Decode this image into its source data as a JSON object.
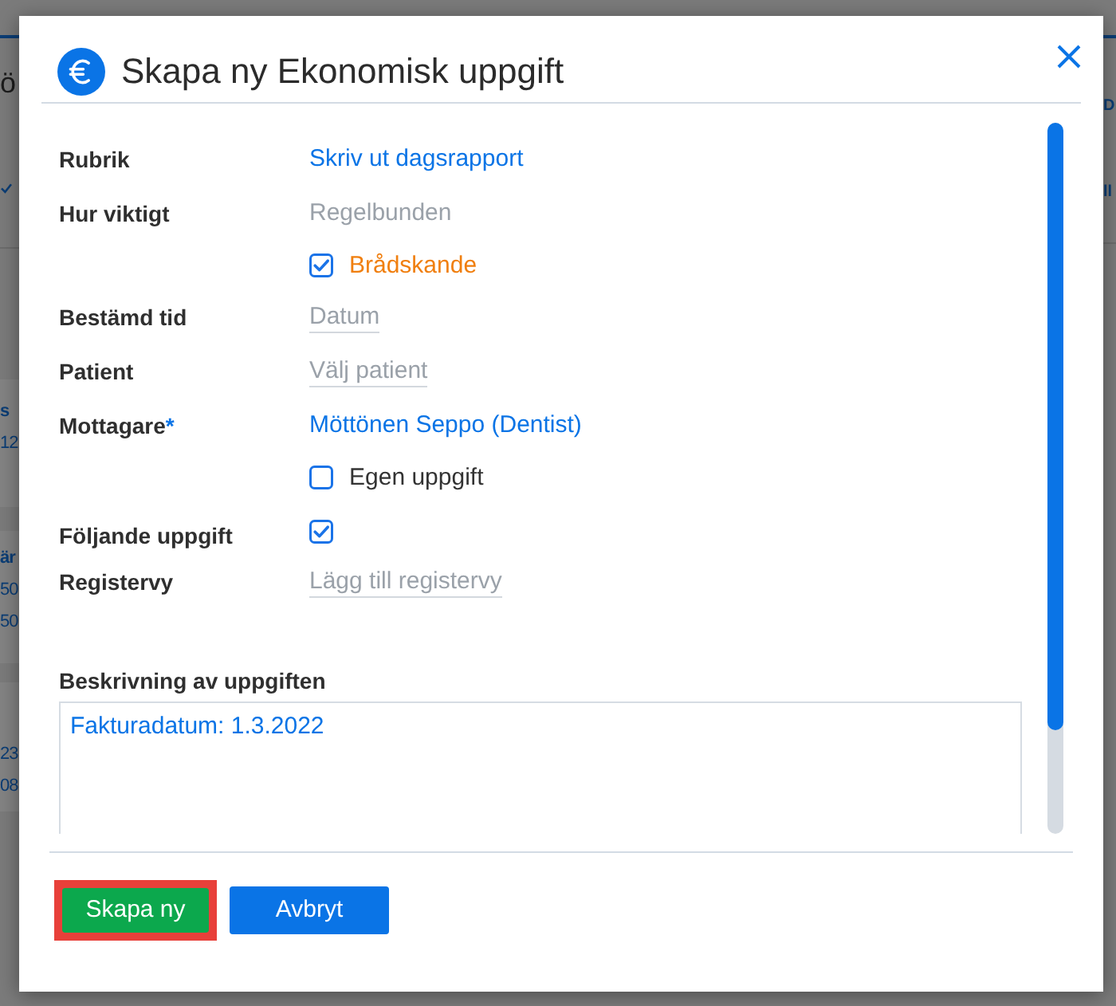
{
  "backdrop": {
    "left_heading": "ö",
    "left_cards": [
      [
        {
          "text": "s",
          "bold": true
        },
        {
          "text": "12",
          "bold": false
        }
      ],
      [
        {
          "text": "är",
          "bold": true
        },
        {
          "text": "50",
          "bold": false
        },
        {
          "text": "50",
          "bold": false
        }
      ],
      [
        {
          "text": "23",
          "bold": false
        },
        {
          "text": "08",
          "bold": false
        }
      ]
    ],
    "right_texts": [
      "D",
      "ll"
    ]
  },
  "dialog": {
    "title": "Skapa ny Ekonomisk uppgift"
  },
  "fields": [
    {
      "kind": "link",
      "label": "Rubrik",
      "value": "Skriv ut dagsrapport"
    },
    {
      "kind": "muted",
      "label": "Hur viktigt",
      "value": "Regelbunden"
    },
    {
      "kind": "checkbox",
      "text": "Brådskande",
      "checked": true,
      "color": "#f07f0f"
    },
    {
      "kind": "picker",
      "label": "Bestämd tid",
      "placeholder": "Datum"
    },
    {
      "kind": "picker",
      "label": "Patient",
      "placeholder": "Välj patient"
    },
    {
      "kind": "link",
      "label": "Mottagare",
      "required_mark": "*",
      "value": "Möttönen Seppo (Dentist)"
    },
    {
      "kind": "checkbox",
      "text": "Egen uppgift",
      "checked": false,
      "color": "#333333"
    },
    {
      "kind": "checkbox",
      "label": "Följande uppgift",
      "checked": true
    },
    {
      "kind": "picker",
      "label": "Registervy",
      "placeholder": "Lägg till registervy"
    }
  ],
  "description": {
    "label": "Beskrivning av uppgiften",
    "value": "Fakturadatum: 1.3.2022"
  },
  "buttons": [
    {
      "label": "Skapa ny",
      "kind": "primary",
      "highlighted": true
    },
    {
      "label": "Avbryt",
      "kind": "secondary",
      "highlighted": false
    }
  ]
}
